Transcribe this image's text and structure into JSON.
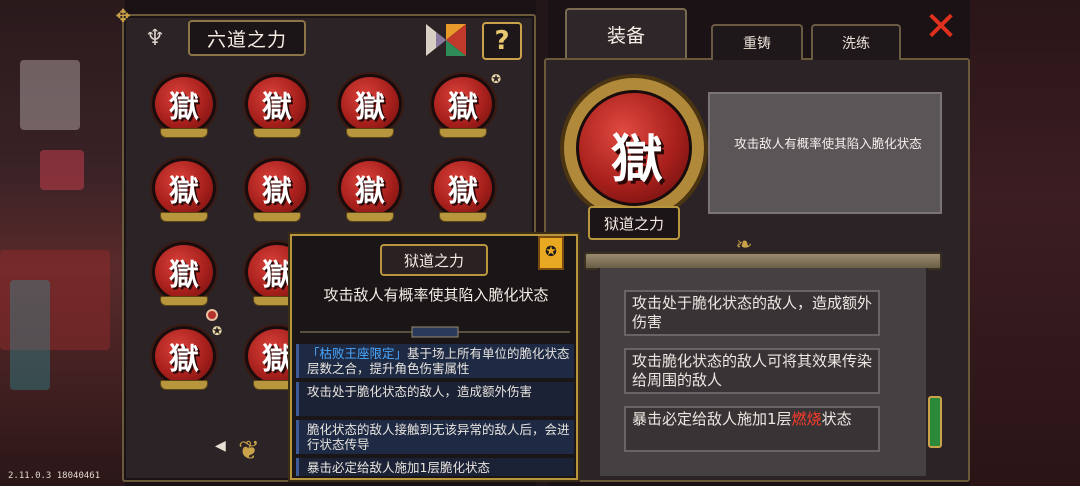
{
  "version": "2.11.0.3 18040461",
  "left_panel": {
    "title": "六道之力",
    "help_label": "?",
    "medal_glyph": "獄",
    "page_prev": "◀"
  },
  "tabs": {
    "equip": "装备",
    "recast": "重铸",
    "refine": "洗练"
  },
  "item": {
    "glyph": "獄",
    "name": "狱道之力",
    "description": "攻击敌人有概率使其陷入脆化状态"
  },
  "effects": [
    "攻击处于脆化状态的敌人，造成额外伤害",
    "攻击脆化状态的敌人可将其效果传染给周围的敌人",
    "暴击必定给敌人施加1层"
  ],
  "effect_burn_word": "燃烧",
  "effect_burn_tail": "状态",
  "tooltip": {
    "title": "狱道之力",
    "badge": "✪",
    "description": "攻击敌人有概率使其陷入脆化状态",
    "rows": {
      "row1_highlight": "「枯败王座限定」",
      "row1_text": "基于场上所有单位的脆化状态层数之合，提升角色伤害属性",
      "row2": "攻击处于脆化状态的敌人，造成额外伤害",
      "row3": "脆化状态的敌人接触到无该异常的敌人后，会进行状态传导",
      "row4": "暴击必定给敌人施加1层脆化状态"
    }
  },
  "colors": {
    "gold": "#c9a24a",
    "medal_red": "#a8201c",
    "burn_red": "#ff3a2a",
    "highlight_blue": "#4aa8ff"
  }
}
